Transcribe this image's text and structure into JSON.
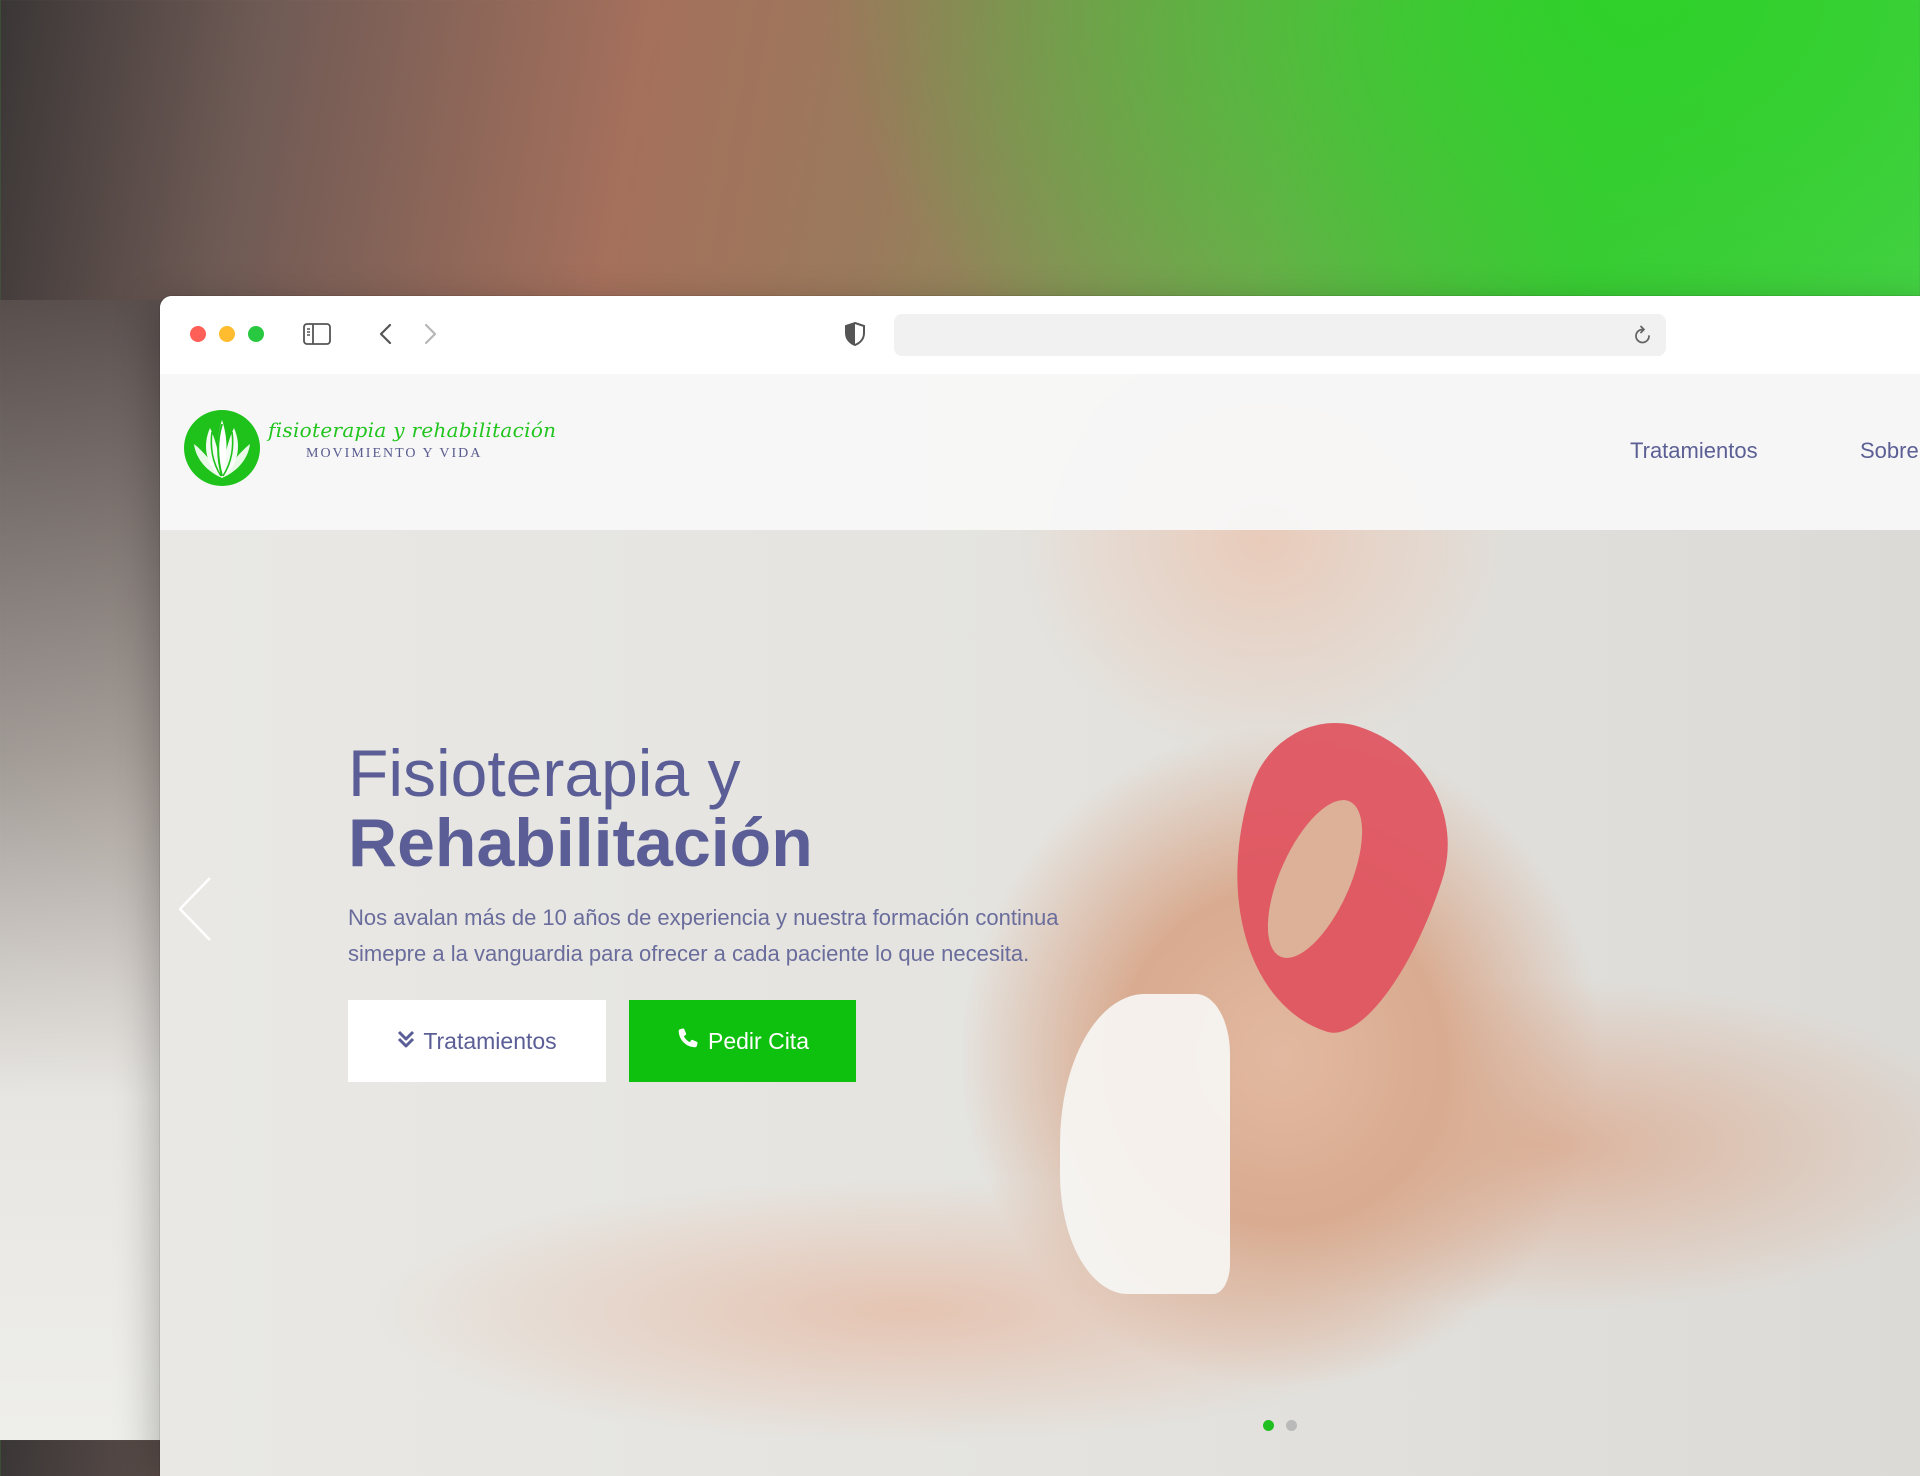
{
  "browser": {
    "url": ""
  },
  "site": {
    "logo_line1": "fisioterapia y rehabilitación",
    "logo_line2": "MOVIMIENTO Y VIDA",
    "brand_color": "#22c51f",
    "accent_color": "#5b5e96"
  },
  "nav": {
    "items": [
      {
        "label": "Tratamientos"
      },
      {
        "label": "Sobre"
      }
    ]
  },
  "hero": {
    "title_line1": "Fisioterapia y",
    "title_line2": "Rehabilitación",
    "subtitle": "Nos avalan más de 10 años de experiencia y nuestra formación continua simepre a la vanguardia para ofrecer a cada paciente lo que necesita.",
    "primary_button": {
      "label": "Tratamientos",
      "icon": "double-chevron-down-icon"
    },
    "cta_button": {
      "label": "Pedir Cita",
      "icon": "phone-icon",
      "color": "#0fc10f"
    },
    "carousel": {
      "slides": 2,
      "active_index": 0,
      "active_color": "#1fbf1f",
      "inactive_color": "#b9b9b9"
    }
  }
}
